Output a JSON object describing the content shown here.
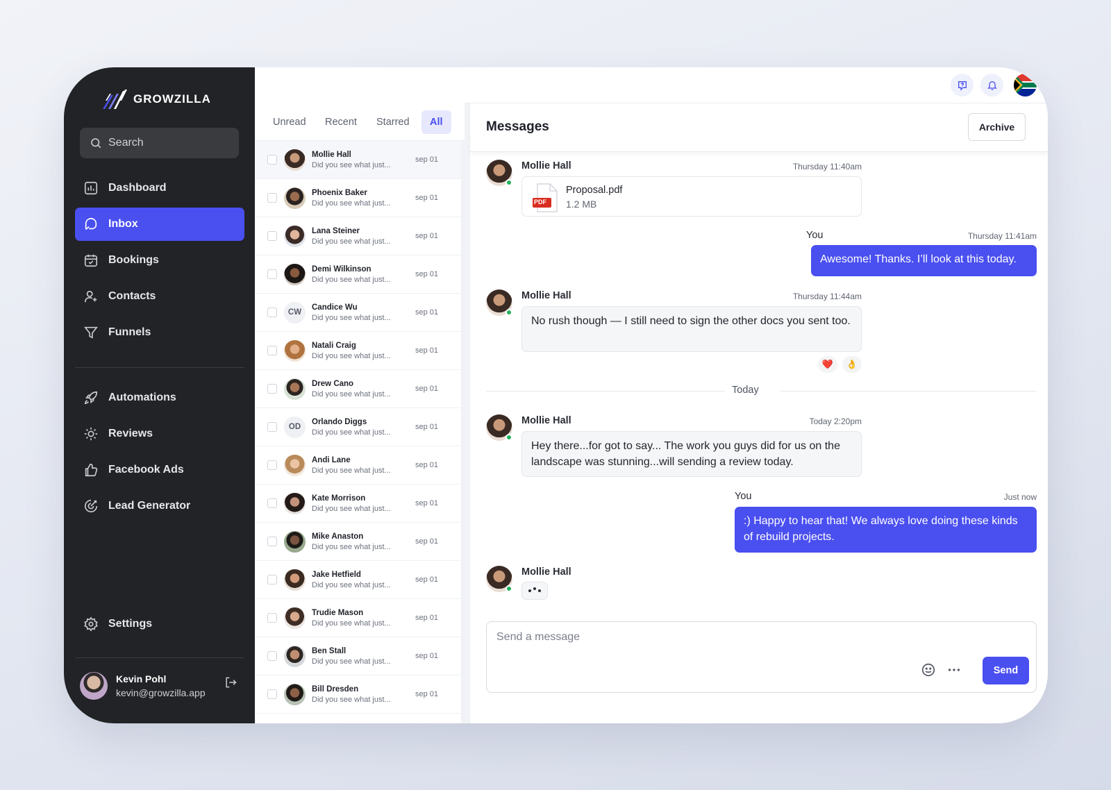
{
  "brand": {
    "name": "GROWZILLA"
  },
  "sidebar": {
    "search_label": "Search",
    "items": [
      {
        "label": "Dashboard",
        "icon": "bar-chart-icon"
      },
      {
        "label": "Inbox",
        "icon": "inbox-icon",
        "active": true
      },
      {
        "label": "Bookings",
        "icon": "calendar-icon"
      },
      {
        "label": "Contacts",
        "icon": "contacts-icon"
      },
      {
        "label": "Funnels",
        "icon": "funnel-icon"
      },
      {
        "label": "Automations",
        "icon": "rocket-icon"
      },
      {
        "label": "Reviews",
        "icon": "sparkle-icon"
      },
      {
        "label": "Facebook Ads",
        "icon": "thumbs-up-icon"
      },
      {
        "label": "Lead Generator",
        "icon": "target-icon"
      }
    ],
    "settings_label": "Settings",
    "user": {
      "name": "Kevin Pohl",
      "email": "kevin@growzilla.app"
    }
  },
  "tabs": [
    {
      "label": "Unread"
    },
    {
      "label": "Recent"
    },
    {
      "label": "Starred"
    },
    {
      "label": "All",
      "active": true
    }
  ],
  "conversations": [
    {
      "name": "Mollie Hall",
      "preview": "Did you see what just...",
      "date": "sep 01"
    },
    {
      "name": "Phoenix Baker",
      "preview": "Did you see what just...",
      "date": "sep 01"
    },
    {
      "name": "Lana Steiner",
      "preview": "Did you see what just...",
      "date": "sep 01"
    },
    {
      "name": "Demi Wilkinson",
      "preview": "Did you see what just...",
      "date": "sep 01"
    },
    {
      "name": "Candice Wu",
      "preview": "Did you see what just...",
      "date": "sep 01",
      "initials": "CW"
    },
    {
      "name": "Natali Craig",
      "preview": "Did you see what just...",
      "date": "sep 01"
    },
    {
      "name": "Drew Cano",
      "preview": "Did you see what just...",
      "date": "sep 01"
    },
    {
      "name": "Orlando Diggs",
      "preview": "Did you see what just...",
      "date": "sep 01",
      "initials": "OD"
    },
    {
      "name": "Andi Lane",
      "preview": "Did you see what just...",
      "date": "sep 01"
    },
    {
      "name": "Kate Morrison",
      "preview": "Did you see what just...",
      "date": "sep 01"
    },
    {
      "name": "Mike Anaston",
      "preview": "Did you see what just...",
      "date": "sep 01"
    },
    {
      "name": "Jake Hetfield",
      "preview": "Did you see what just...",
      "date": "sep 01"
    },
    {
      "name": "Trudie Mason",
      "preview": "Did you see what just...",
      "date": "sep 01"
    },
    {
      "name": "Ben Stall",
      "preview": "Did you see what just...",
      "date": "sep 01"
    },
    {
      "name": "Bill Dresden",
      "preview": "Did you see what just...",
      "date": "sep 01"
    }
  ],
  "topbar": {
    "icons": [
      "help-icon",
      "bell-icon",
      "flag-icon"
    ]
  },
  "messages": {
    "title": "Messages",
    "archive_label": "Archive",
    "thread": [
      {
        "sender": "Mollie Hall",
        "time": "Thursday 11:40am",
        "file": {
          "badge": "PDF",
          "name": "Proposal.pdf",
          "size": "1.2 MB"
        }
      },
      {
        "sender": "You",
        "time": "Thursday 11:41am",
        "text": "Awesome! Thanks. I’ll look at this today."
      },
      {
        "sender": "Mollie Hall",
        "time": "Thursday 11:44am",
        "text": "No rush though — I still need to sign the other docs you sent too.",
        "reactions": [
          "❤️",
          "👌"
        ]
      },
      {
        "sender": "Mollie Hall",
        "time": "Today 2:20pm",
        "text": "Hey there...for got to say... The work you guys did for us on the landscape was stunning...will sending a review today."
      },
      {
        "sender": "You",
        "time": "Just now",
        "text": ":) Happy to hear that! We always love doing these kinds of rebuild projects."
      },
      {
        "sender": "Mollie Hall",
        "typing": true
      }
    ],
    "divider_label": "Today",
    "composer": {
      "placeholder": "Send a message",
      "value": "",
      "send_label": "Send"
    }
  },
  "colors": {
    "accent": "#4a4ff0",
    "sidebar_bg": "#222326",
    "online": "#22b35e"
  }
}
